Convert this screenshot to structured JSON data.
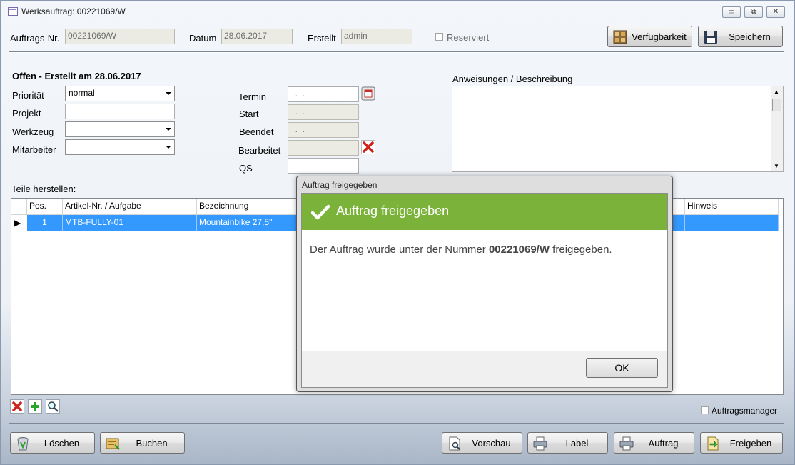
{
  "window": {
    "title": "Werksauftrag: 00221069/W",
    "controls": {
      "minimize": "▭",
      "restore": "⧉",
      "close": "✕"
    }
  },
  "header": {
    "order_no_label": "Auftrags-Nr.",
    "order_no_value": "00221069/W",
    "date_label": "Datum",
    "date_value": "28.06.2017",
    "created_label": "Erstellt",
    "created_value": "admin",
    "reserved_label": "Reserviert",
    "availability_button": "Verfügbarkeit",
    "save_button": "Speichern"
  },
  "form": {
    "status_text": "Offen - Erstellt am 28.06.2017",
    "priority_label": "Priorität",
    "priority_value": "normal",
    "project_label": "Projekt",
    "project_value": "",
    "tool_label": "Werkzeug",
    "tool_value": "",
    "employee_label": "Mitarbeiter",
    "employee_value": "",
    "deadline_label": "Termin",
    "deadline_value": "  .  .",
    "start_label": "Start",
    "start_value": "  .  .",
    "finished_label": "Beendet",
    "finished_value": "  .  .",
    "edited_label": "Bearbeitet",
    "edited_value": "",
    "qs_label": "QS",
    "qs_value": "",
    "instructions_label": "Anweisungen / Beschreibung"
  },
  "parts": {
    "section_label": "Teile herstellen:",
    "columns": {
      "pos": "Pos.",
      "article": "Artikel-Nr. / Aufgabe",
      "description": "Bezeichnung",
      "note": "Hinweis"
    },
    "rows": [
      {
        "pos": "1",
        "article": "MTB-FULLY-01",
        "description": "Mountainbike 27,5\"",
        "note": ""
      }
    ],
    "row_indicator": "▶"
  },
  "order_manager_label": "Auftragsmanager",
  "footer": {
    "delete_button": "Löschen",
    "book_button": "Buchen",
    "preview_button": "Vorschau",
    "label_button": "Label",
    "order_button": "Auftrag",
    "release_button": "Freigeben"
  },
  "dialog": {
    "title": "Auftrag freigegeben",
    "heading": "Auftrag freigegeben",
    "message_prefix": "Der Auftrag wurde unter der Nummer ",
    "message_number": "00221069/W",
    "message_suffix": " freigegeben.",
    "ok_button": "OK"
  },
  "colors": {
    "dialog_header": "#7bb33a",
    "selection": "#3399ff"
  }
}
